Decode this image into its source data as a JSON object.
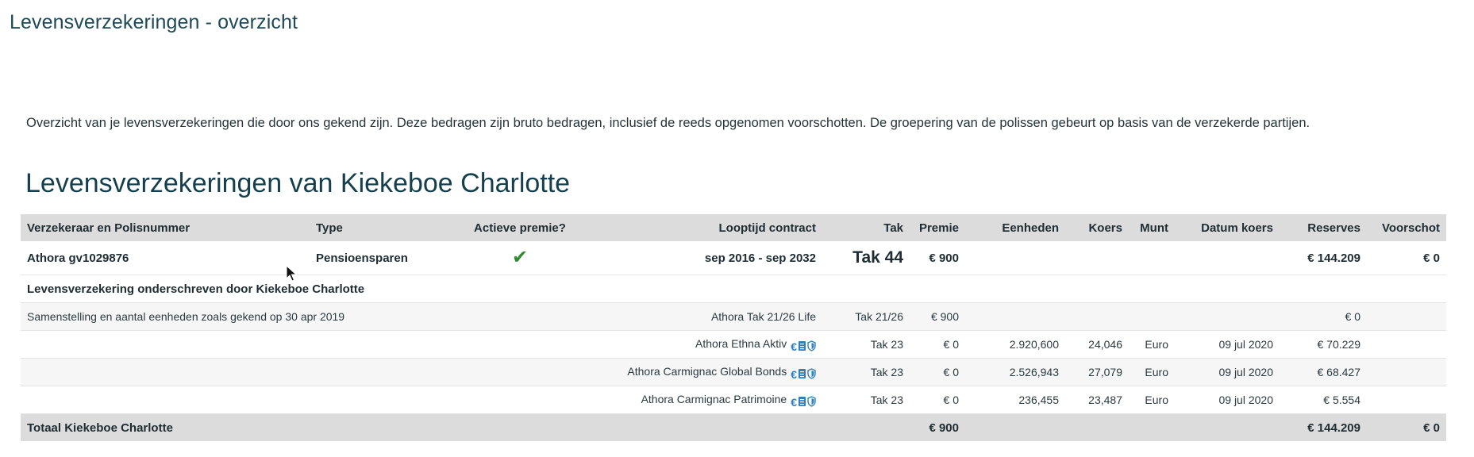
{
  "page": {
    "title": "Levensverzekeringen - overzicht",
    "intro": "Overzicht van je levensverzekeringen die door ons gekend zijn. Deze bedragen zijn bruto bedragen, inclusief de reeds opgenomen voorschotten. De groepering van de polissen gebeurt op basis van de verzekerde partijen."
  },
  "section": {
    "title": "Levensverzekeringen van Kiekeboe Charlotte"
  },
  "table": {
    "headers": {
      "insurer": "Verzekeraar en Polisnummer",
      "type": "Type",
      "active": "Actieve premie?",
      "term": "Looptijd contract",
      "tak": "Tak",
      "premium": "Premie",
      "units": "Eenheden",
      "rate": "Koers",
      "currency": "Munt",
      "rate_date": "Datum koers",
      "reserves": "Reserves",
      "advance": "Voorschot"
    },
    "policy": {
      "insurer": "Athora gv1029876",
      "type": "Pensioensparen",
      "active_icon": "checkmark-icon",
      "term": "sep 2016 - sep 2032",
      "tak": "Tak 44",
      "premium": "€ 900",
      "reserves": "€ 144.209",
      "advance": "€ 0"
    },
    "subhead": "Levensverzekering onderschreven door Kiekeboe Charlotte",
    "composition": {
      "label": "Samenstelling en aantal eenheden zoals gekend op 30 apr 2019",
      "fund": "Athora Tak 21/26 Life",
      "tak": "Tak 21/26",
      "premium": "€ 900",
      "reserves": "€ 0"
    },
    "funds": [
      {
        "name": "Athora Ethna Aktiv",
        "tak": "Tak 23",
        "premium": "€ 0",
        "units": "2.920,600",
        "rate": "24,046",
        "currency": "Euro",
        "rate_date": "09 jul 2020",
        "reserves": "€ 70.229"
      },
      {
        "name": "Athora Carmignac Global Bonds",
        "tak": "Tak 23",
        "premium": "€ 0",
        "units": "2.526,943",
        "rate": "27,079",
        "currency": "Euro",
        "rate_date": "09 jul 2020",
        "reserves": "€ 68.427"
      },
      {
        "name": "Athora Carmignac Patrimoine",
        "tak": "Tak 23",
        "premium": "€ 0",
        "units": "236,455",
        "rate": "23,487",
        "currency": "Euro",
        "rate_date": "09 jul 2020",
        "reserves": "€ 5.554"
      }
    ],
    "fund_icons": {
      "euro": "€",
      "names": [
        "euro-icon",
        "document-icon",
        "shield-icon"
      ]
    },
    "total": {
      "label": "Totaal Kiekeboe Charlotte",
      "premium": "€ 900",
      "reserves": "€ 144.209",
      "advance": "€ 0"
    }
  },
  "colors": {
    "title": "#1e4a57",
    "header_bg": "#dcdcdc",
    "check": "#2e8b2e",
    "icon_blue": "#2f7fc1"
  }
}
